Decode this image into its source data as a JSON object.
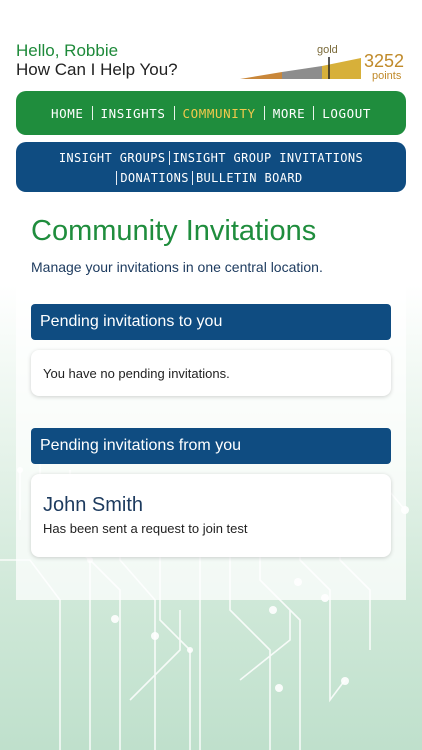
{
  "header": {
    "greeting": "Hello, Robbie",
    "subgreeting": "How Can I Help You?",
    "tier": "gold",
    "points": "3252",
    "points_label": "points",
    "gauge_colors": [
      "#c9873a",
      "#8d8d8d",
      "#d7b03a"
    ]
  },
  "nav": {
    "items": [
      {
        "label": "HOME"
      },
      {
        "label": "INSIGHTS"
      },
      {
        "label": "COMMUNITY"
      },
      {
        "label": "MORE"
      },
      {
        "label": "LOGOUT"
      }
    ]
  },
  "subnav": {
    "items": [
      {
        "label": "INSIGHT GROUPS"
      },
      {
        "label": "INSIGHT GROUP INVITATIONS"
      },
      {
        "label": "DONATIONS"
      },
      {
        "label": "BULLETIN BOARD"
      }
    ]
  },
  "main": {
    "title": "Community Invitations",
    "description": "Manage your invitations in one central location.",
    "pending_to_you": {
      "heading": "Pending invitations to you",
      "message": "You have no pending invitations."
    },
    "pending_from_you": {
      "heading": "Pending invitations from you",
      "invitations": [
        {
          "name": "John Smith",
          "status": "Has been sent a request to join test"
        }
      ]
    }
  },
  "colors": {
    "brand_green": "#1f8d3d",
    "brand_blue": "#0f4c81",
    "active_nav": "#f2c94c"
  }
}
